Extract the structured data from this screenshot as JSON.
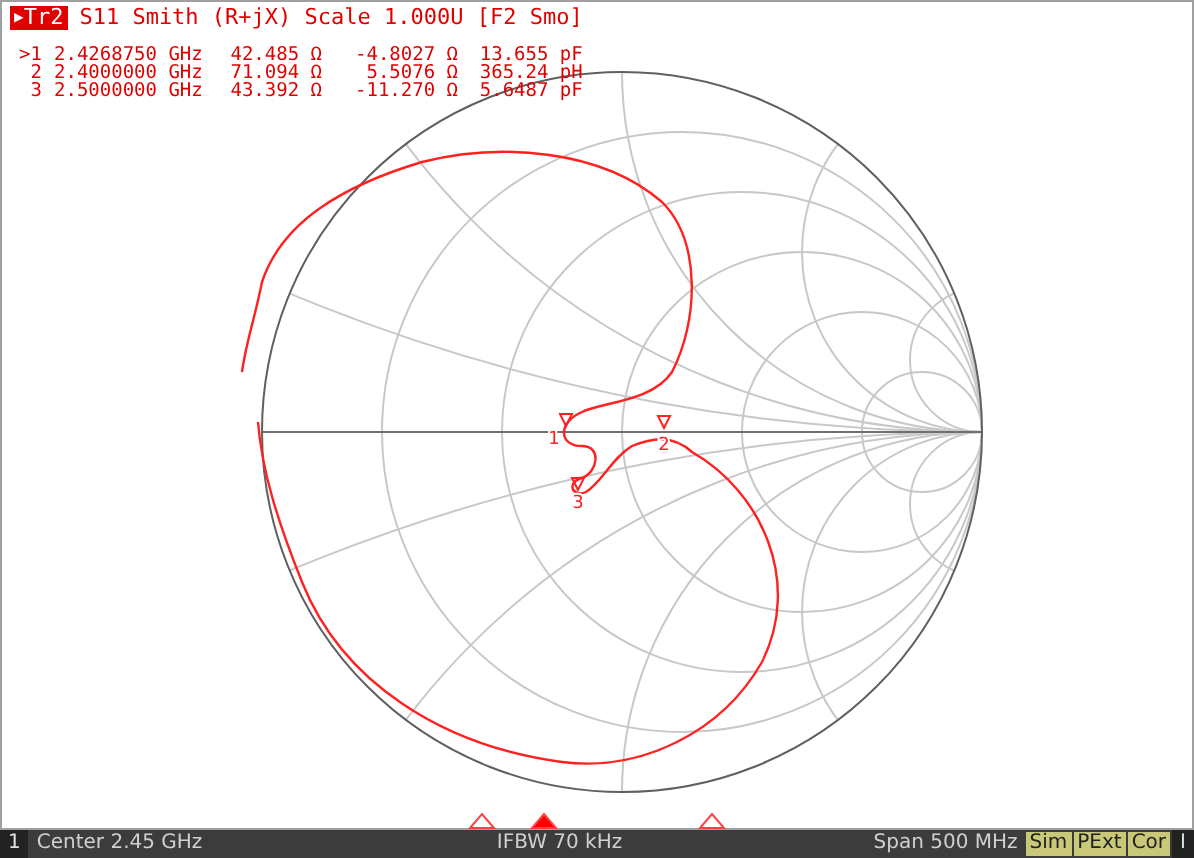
{
  "trace": {
    "marker_arrow": "▶",
    "name": "Tr2",
    "info": "S11 Smith (R+jX) Scale 1.000U [F2 Smo]"
  },
  "marker_table": [
    {
      "active": ">",
      "number": "1",
      "frequency": "2.4268750 GHz",
      "resistance": "42.485 Ω",
      "reactance": "-4.8027 Ω",
      "component": "13.655 pF"
    },
    {
      "number": "2",
      "frequency": "2.4000000 GHz",
      "resistance": "71.094 Ω",
      "reactance": "5.5076 Ω",
      "component": "365.24 pH"
    },
    {
      "number": "3",
      "frequency": "2.5000000 GHz",
      "resistance": "43.392 Ω",
      "reactance": "-11.270 Ω",
      "component": "5.6487 pF"
    }
  ],
  "chart_markers": [
    {
      "label": "1"
    },
    {
      "label": "2"
    },
    {
      "label": "3"
    }
  ],
  "axis_markers": [
    {
      "selected": false
    },
    {
      "selected": true
    },
    {
      "selected": false
    }
  ],
  "status_bar": {
    "channel": "1",
    "center": "Center 2.45 GHz",
    "ifbw": "IFBW 70 kHz",
    "span": "Span 500 MHz",
    "badges": [
      "Sim",
      "PExt",
      "Cor"
    ],
    "end": "I"
  }
}
